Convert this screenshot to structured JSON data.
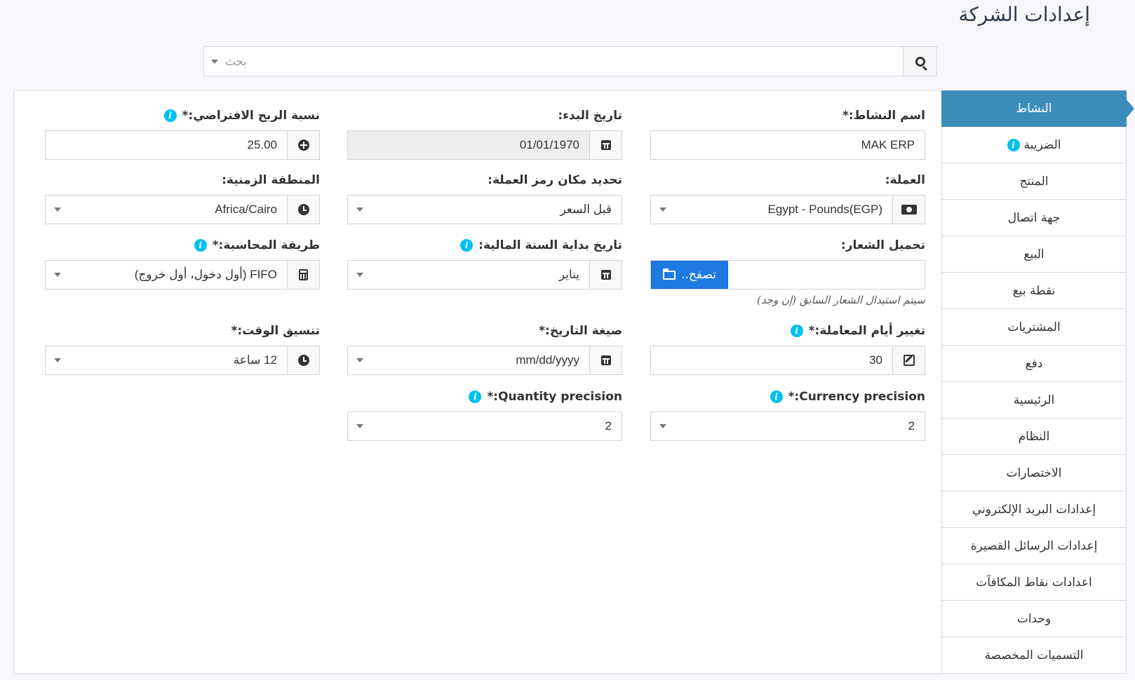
{
  "page_title": "إعدادات الشركة",
  "search": {
    "placeholder": "بحث"
  },
  "side_menu": [
    {
      "label": "النشاط",
      "active": true
    },
    {
      "label": "الضريبة",
      "info": true
    },
    {
      "label": "المنتج"
    },
    {
      "label": "جهة اتصال"
    },
    {
      "label": "البيع"
    },
    {
      "label": "نقطة بيع"
    },
    {
      "label": "المشتريات"
    },
    {
      "label": "دفع"
    },
    {
      "label": "الرئيسية"
    },
    {
      "label": "النظام"
    },
    {
      "label": "الاختصارات"
    },
    {
      "label": "إعدادات البريد الإلكتروني"
    },
    {
      "label": "إعدادات الرسائل القصيرة"
    },
    {
      "label": "اعدادات نقاط المكافآت"
    },
    {
      "label": "وحدات"
    },
    {
      "label": "التسميات المخصصة"
    }
  ],
  "form": {
    "business_name": {
      "label": "اسم النشاط:*",
      "value": "MAK ERP"
    },
    "start_date": {
      "label": "تاريخ البدء:",
      "value": "01/01/1970"
    },
    "profit_percent": {
      "label": "نسبة الربح الافتراضي:*",
      "value": "25.00"
    },
    "currency": {
      "label": "العملة:",
      "value": "Egypt - Pounds(EGP)"
    },
    "currency_symbol_placement": {
      "label": "تحديد مكان رمز العملة:",
      "value": "قبل السعر"
    },
    "time_zone": {
      "label": "المنطقة الزمنية:",
      "value": "Africa/Cairo"
    },
    "logo": {
      "label": "تحميل الشعار:",
      "browse": "تصفح..",
      "hint": "سيتم استبدال الشعار السابق (إن وجد)"
    },
    "fy_start_month": {
      "label": "تاريخ بداية السنة المالية:",
      "value": "يناير"
    },
    "accounting_method": {
      "label": "طريقة المحاسبة:*",
      "value": "FIFO (أول دخول، أول خروج)"
    },
    "transaction_edit_days": {
      "label": "تغيير أيام المعاملة:*",
      "value": "30"
    },
    "date_format": {
      "label": "صيغة التاريخ:*",
      "value": "mm/dd/yyyy"
    },
    "time_format": {
      "label": "تنسيق الوقت:*",
      "value": "12 ساعة"
    },
    "currency_precision": {
      "label": "Currency precision:*",
      "value": "2"
    },
    "quantity_precision": {
      "label": "Quantity precision:*",
      "value": "2"
    }
  },
  "colors": {
    "accent": "#3c8dbc",
    "browse": "#1e7ae2",
    "info": "#00c0ef"
  }
}
